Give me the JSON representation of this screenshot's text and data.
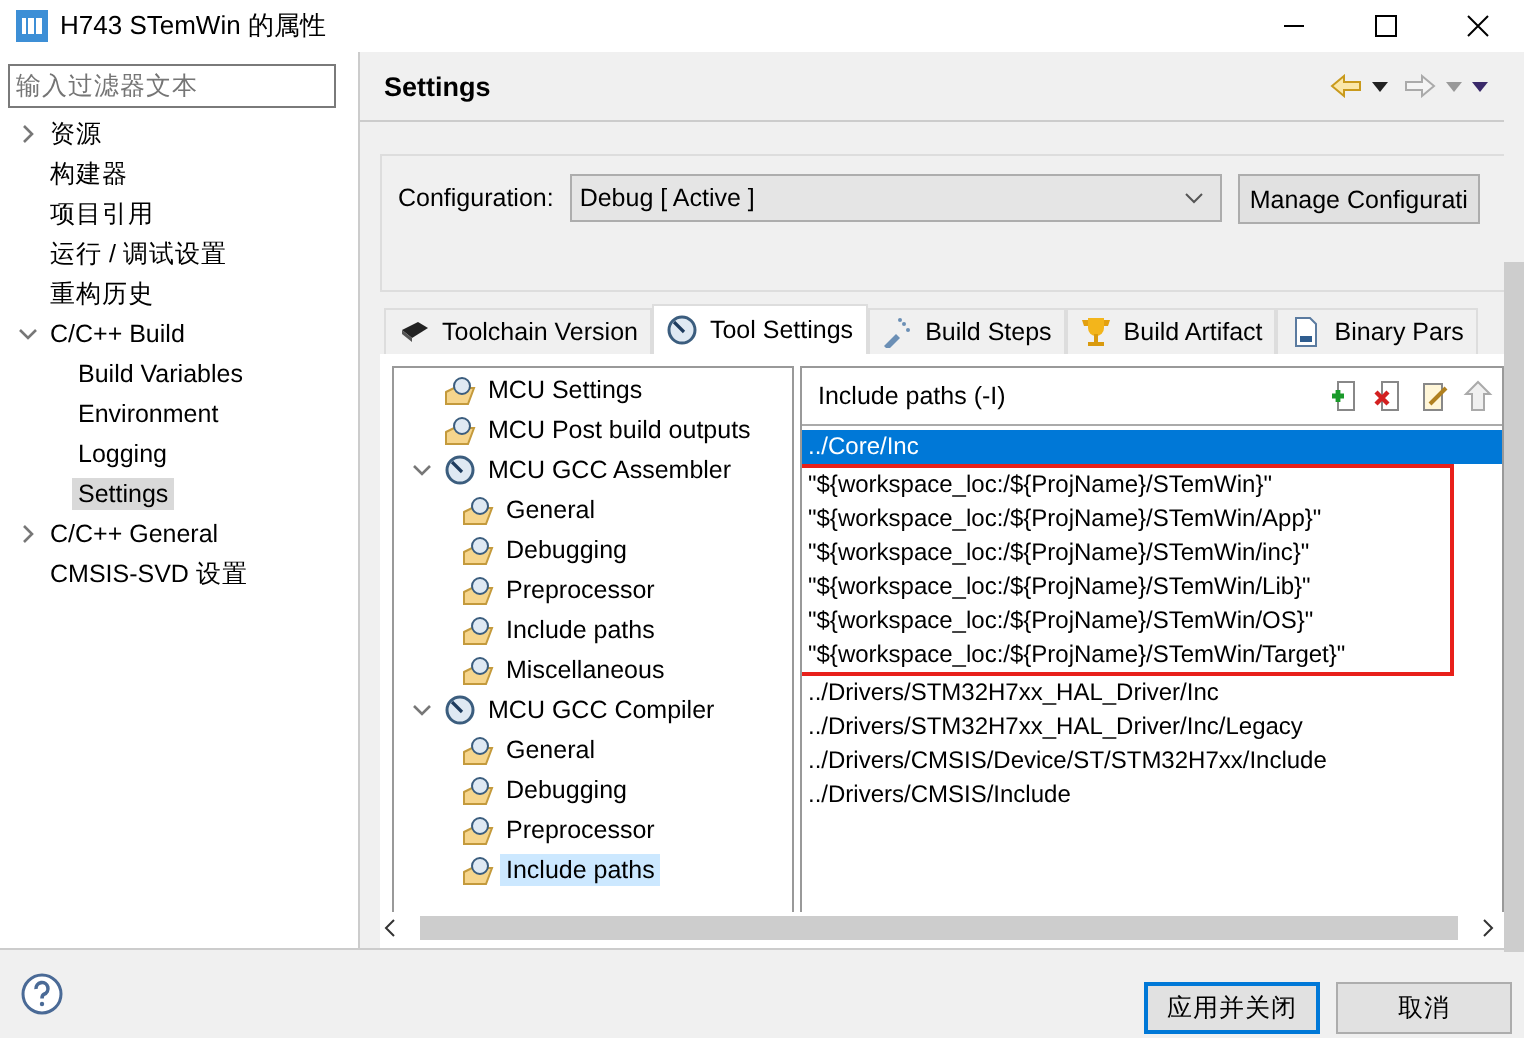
{
  "window": {
    "title": "H743 STemWin 的属性"
  },
  "filter": {
    "placeholder": "输入过滤器文本"
  },
  "nav": [
    {
      "label": "资源",
      "expanded": false,
      "selected": false
    },
    {
      "label": "构建器",
      "selected": false
    },
    {
      "label": "项目引用",
      "selected": false
    },
    {
      "label": "运行 / 调试设置",
      "selected": false
    },
    {
      "label": "重构历史",
      "selected": false
    },
    {
      "label": "C/C++ Build",
      "expanded": true,
      "selected": false,
      "children": [
        {
          "label": "Build Variables",
          "selected": false
        },
        {
          "label": "Environment",
          "selected": false
        },
        {
          "label": "Logging",
          "selected": false
        },
        {
          "label": "Settings",
          "selected": true
        }
      ]
    },
    {
      "label": "C/C++ General",
      "expanded": false,
      "selected": false
    },
    {
      "label": "CMSIS-SVD 设置",
      "selected": false
    }
  ],
  "page_title": "Settings",
  "configuration": {
    "label": "Configuration:",
    "value": "Debug  [ Active ]",
    "button": "Manage Configurati"
  },
  "tabs": [
    {
      "label": "Toolchain  Version",
      "kind": "chip",
      "selected": false
    },
    {
      "label": "Tool Settings",
      "kind": "gauge",
      "selected": true
    },
    {
      "label": "Build Steps",
      "kind": "steps",
      "selected": false
    },
    {
      "label": "Build Artifact",
      "kind": "trophy",
      "selected": false
    },
    {
      "label": "Binary Pars",
      "kind": "binary",
      "selected": false
    }
  ],
  "tool_tree": [
    {
      "label": "MCU Settings",
      "selected": false
    },
    {
      "label": "MCU Post build outputs",
      "selected": false
    },
    {
      "label": "MCU GCC Assembler",
      "expanded": true,
      "selected": false,
      "children": [
        {
          "label": "General",
          "selected": false
        },
        {
          "label": "Debugging",
          "selected": false
        },
        {
          "label": "Preprocessor",
          "selected": false
        },
        {
          "label": "Include paths",
          "selected": false
        },
        {
          "label": "Miscellaneous",
          "selected": false
        }
      ]
    },
    {
      "label": "MCU GCC Compiler",
      "expanded": true,
      "selected": false,
      "children": [
        {
          "label": "General",
          "selected": false
        },
        {
          "label": "Debugging",
          "selected": false
        },
        {
          "label": "Preprocessor",
          "selected": false
        },
        {
          "label": "Include paths",
          "selected": true
        }
      ]
    }
  ],
  "include_paths": {
    "title": "Include paths (-I)",
    "items": [
      {
        "path": "../Core/Inc",
        "selected": true,
        "boxed": false
      },
      {
        "path": "\"${workspace_loc:/${ProjName}/STemWin}\"",
        "selected": false,
        "boxed": true
      },
      {
        "path": "\"${workspace_loc:/${ProjName}/STemWin/App}\"",
        "selected": false,
        "boxed": true
      },
      {
        "path": "\"${workspace_loc:/${ProjName}/STemWin/inc}\"",
        "selected": false,
        "boxed": true
      },
      {
        "path": "\"${workspace_loc:/${ProjName}/STemWin/Lib}\"",
        "selected": false,
        "boxed": true
      },
      {
        "path": "\"${workspace_loc:/${ProjName}/STemWin/OS}\"",
        "selected": false,
        "boxed": true
      },
      {
        "path": "\"${workspace_loc:/${ProjName}/STemWin/Target}\"",
        "selected": false,
        "boxed": true
      },
      {
        "path": "../Drivers/STM32H7xx_HAL_Driver/Inc",
        "selected": false,
        "boxed": false
      },
      {
        "path": "../Drivers/STM32H7xx_HAL_Driver/Inc/Legacy",
        "selected": false,
        "boxed": false
      },
      {
        "path": "../Drivers/CMSIS/Device/ST/STM32H7xx/Include",
        "selected": false,
        "boxed": false
      },
      {
        "path": "../Drivers/CMSIS/Include",
        "selected": false,
        "boxed": false
      }
    ]
  },
  "buttons": [
    {
      "label": "应用并关闭",
      "kind": "default"
    },
    {
      "label": "取消",
      "kind": "normal"
    }
  ]
}
